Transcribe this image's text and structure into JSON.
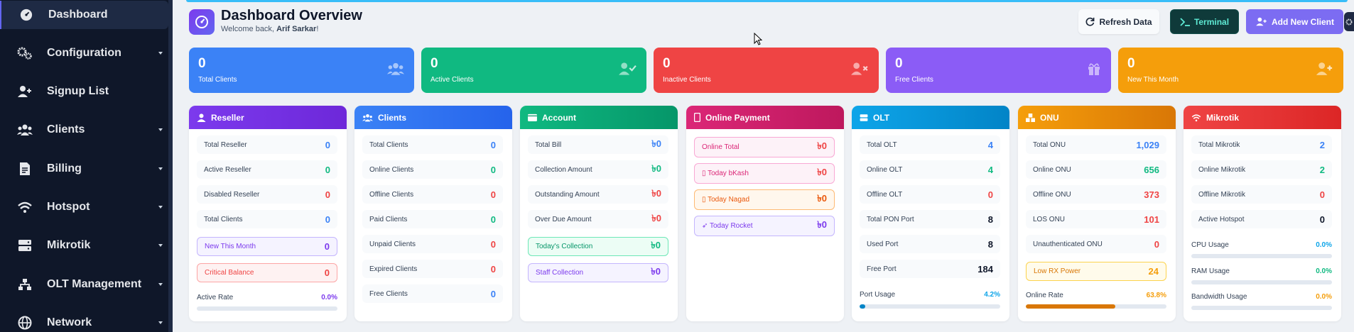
{
  "sidebar": {
    "items": [
      {
        "label": "Dashboard",
        "icon": "dashboard-icon"
      },
      {
        "label": "Configuration",
        "icon": "gears-icon"
      },
      {
        "label": "Signup List",
        "icon": "user-plus-icon"
      },
      {
        "label": "Clients",
        "icon": "users-icon"
      },
      {
        "label": "Billing",
        "icon": "invoice-icon"
      },
      {
        "label": "Hotspot",
        "icon": "wifi-icon"
      },
      {
        "label": "Mikrotik",
        "icon": "server-icon"
      },
      {
        "label": "OLT Management",
        "icon": "sitemap-icon"
      },
      {
        "label": "Network",
        "icon": "globe-icon"
      }
    ]
  },
  "header": {
    "title": "Dashboard Overview",
    "welcome_prefix": "Welcome back, ",
    "user_name": "Arif Sarkar",
    "welcome_suffix": "!",
    "refresh_label": "Refresh Data",
    "terminal_label": "Terminal",
    "add_client_label": "Add New Client"
  },
  "stats": [
    {
      "value": "0",
      "label": "Total Clients",
      "color": "#3b82f6",
      "icon": "users-icon"
    },
    {
      "value": "0",
      "label": "Active Clients",
      "color": "#10b981",
      "icon": "user-check-icon"
    },
    {
      "value": "0",
      "label": "Inactive Clients",
      "color": "#ef4444",
      "icon": "user-times-icon"
    },
    {
      "value": "0",
      "label": "Free Clients",
      "color": "#8b5cf6",
      "icon": "gift-icon"
    },
    {
      "value": "0",
      "label": "New This Month",
      "color": "#f59e0b",
      "icon": "user-plus-icon"
    }
  ],
  "panels": {
    "reseller": {
      "title": "Reseller",
      "rows": [
        {
          "label": "Total Reseller",
          "value": "0"
        },
        {
          "label": "Active Reseller",
          "value": "0"
        },
        {
          "label": "Disabled Reseller",
          "value": "0"
        },
        {
          "label": "Total Clients",
          "value": "0"
        },
        {
          "label": "New This Month",
          "value": "0"
        },
        {
          "label": "Critical Balance",
          "value": "0"
        }
      ],
      "rate_label": "Active Rate",
      "rate_value": "0.0%",
      "rate_fraction": 0.0
    },
    "clients": {
      "title": "Clients",
      "rows": [
        {
          "label": "Total Clients",
          "value": "0"
        },
        {
          "label": "Online Clients",
          "value": "0"
        },
        {
          "label": "Offline Clients",
          "value": "0"
        },
        {
          "label": "Paid Clients",
          "value": "0"
        },
        {
          "label": "Unpaid Clients",
          "value": "0"
        },
        {
          "label": "Expired Clients",
          "value": "0"
        },
        {
          "label": "Free Clients",
          "value": "0"
        }
      ]
    },
    "account": {
      "title": "Account",
      "rows": [
        {
          "label": "Total Bill",
          "value": "৳0"
        },
        {
          "label": "Collection Amount",
          "value": "৳0"
        },
        {
          "label": "Outstanding Amount",
          "value": "৳0"
        },
        {
          "label": "Over Due Amount",
          "value": "৳0"
        },
        {
          "label": "Today's Collection",
          "value": "৳0"
        },
        {
          "label": "Staff Collection",
          "value": "৳0"
        }
      ]
    },
    "online_payment": {
      "title": "Online Payment",
      "rows": [
        {
          "label": "Online Total",
          "value": "৳0"
        },
        {
          "label": "Today bKash",
          "value": "৳0"
        },
        {
          "label": "Today Nagad",
          "value": "৳0"
        },
        {
          "label": "Today Rocket",
          "value": "৳0"
        }
      ]
    },
    "olt": {
      "title": "OLT",
      "rows": [
        {
          "label": "Total OLT",
          "value": "4"
        },
        {
          "label": "Online OLT",
          "value": "4"
        },
        {
          "label": "Offline OLT",
          "value": "0"
        },
        {
          "label": "Total PON Port",
          "value": "8"
        },
        {
          "label": "Used Port",
          "value": "8"
        },
        {
          "label": "Free Port",
          "value": "184"
        }
      ],
      "usage_label": "Port Usage",
      "usage_value": "4.2%",
      "usage_fraction": 0.042
    },
    "onu": {
      "title": "ONU",
      "rows": [
        {
          "label": "Total ONU",
          "value": "1,029"
        },
        {
          "label": "Online ONU",
          "value": "656"
        },
        {
          "label": "Offline ONU",
          "value": "373"
        },
        {
          "label": "LOS ONU",
          "value": "101"
        },
        {
          "label": "Unauthenticated ONU",
          "value": "0"
        },
        {
          "label": "Low RX Power",
          "value": "24"
        }
      ],
      "rate_label": "Online Rate",
      "rate_value": "63.8%",
      "rate_fraction": 0.638
    },
    "mikrotik": {
      "title": "Mikrotik",
      "rows": [
        {
          "label": "Total Mikrotik",
          "value": "2"
        },
        {
          "label": "Online Mikrotik",
          "value": "2"
        },
        {
          "label": "Offline Mikrotik",
          "value": "0"
        },
        {
          "label": "Active Hotspot",
          "value": "0"
        }
      ],
      "bars": [
        {
          "label": "CPU Usage",
          "value": "0.0%",
          "fraction": 0.0
        },
        {
          "label": "RAM Usage",
          "value": "0.0%",
          "fraction": 0.0
        },
        {
          "label": "Bandwidth Usage",
          "value": "0.0%",
          "fraction": 0.0
        }
      ]
    }
  }
}
